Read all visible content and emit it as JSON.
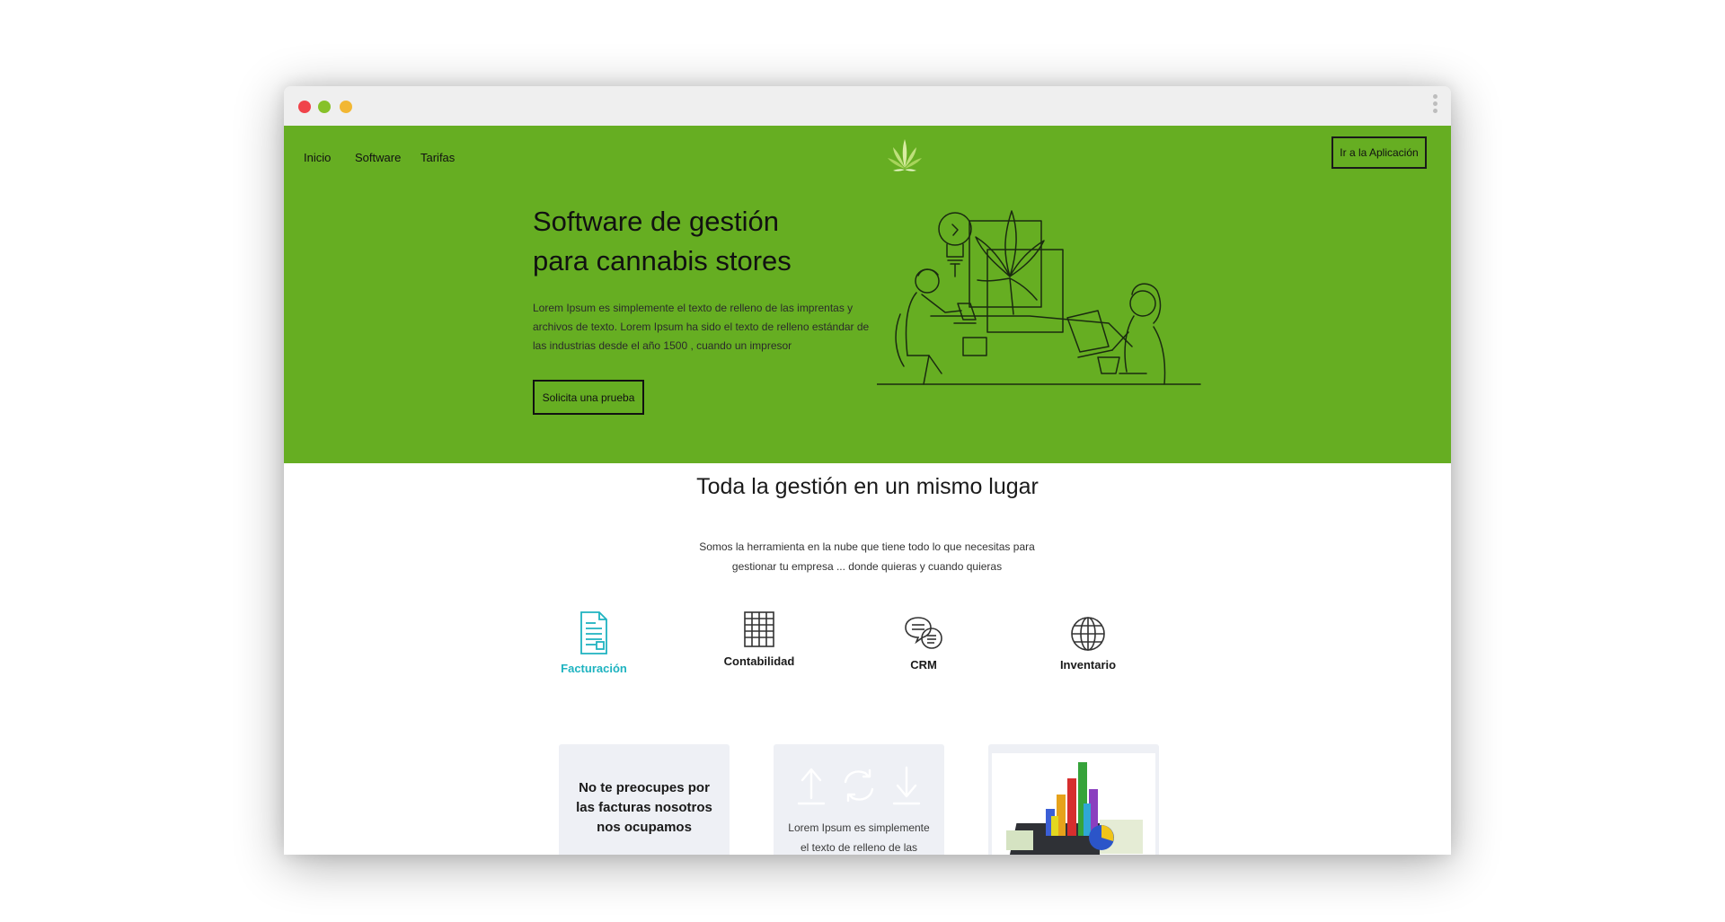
{
  "window": {
    "controls": [
      "close",
      "minimize",
      "zoom"
    ],
    "colors": {
      "close": "#f0434a",
      "minimize": "#86c129",
      "zoom": "#f2b733"
    },
    "menu_icon": "kebab-menu-icon"
  },
  "theme": {
    "brand_green": "#66ae22",
    "accent_teal": "#1eb3c0",
    "card_bg": "#eef0f5"
  },
  "nav": {
    "items": [
      {
        "label": "Inicio"
      },
      {
        "label": "Software"
      },
      {
        "label": "Tarifas"
      }
    ],
    "logo": "cannabis-leaf-logo",
    "app_button": "Ir a la Aplicación"
  },
  "hero": {
    "title_line1": "Software de gestión",
    "title_line2": "para cannabis stores",
    "description": "Lorem Ipsum es simplemente el texto de relleno de las imprentas y archivos de texto. Lorem Ipsum ha sido el texto de relleno estándar de las industrias desde el año 1500 , cuando un impresor",
    "cta": "Solicita una prueba",
    "illustration": "team-working-line-art"
  },
  "features_section": {
    "title": "Toda la gestión en un mismo lugar",
    "subtitle_line1": "Somos la herramienta en la nube que tiene todo lo que necesitas para",
    "subtitle_line2": "gestionar tu empresa ... donde quieras y cuando quieras",
    "items": [
      {
        "label": "Facturación",
        "icon": "invoice-icon",
        "active": true
      },
      {
        "label": "Contabilidad",
        "icon": "ledger-icon",
        "active": false
      },
      {
        "label": "CRM",
        "icon": "chat-bubbles-icon",
        "active": false
      },
      {
        "label": "Inventario",
        "icon": "globe-icon",
        "active": false
      }
    ]
  },
  "cards": {
    "card1": {
      "text": "No te preocupes por las facturas nosotros nos ocupamos"
    },
    "card2": {
      "text": "Lorem Ipsum es simplemente el texto de relleno de las",
      "icons": [
        "upload-arrow-icon",
        "sync-icon",
        "download-arrow-icon"
      ]
    },
    "card3": {
      "image": "3d-bar-chart-image"
    }
  }
}
